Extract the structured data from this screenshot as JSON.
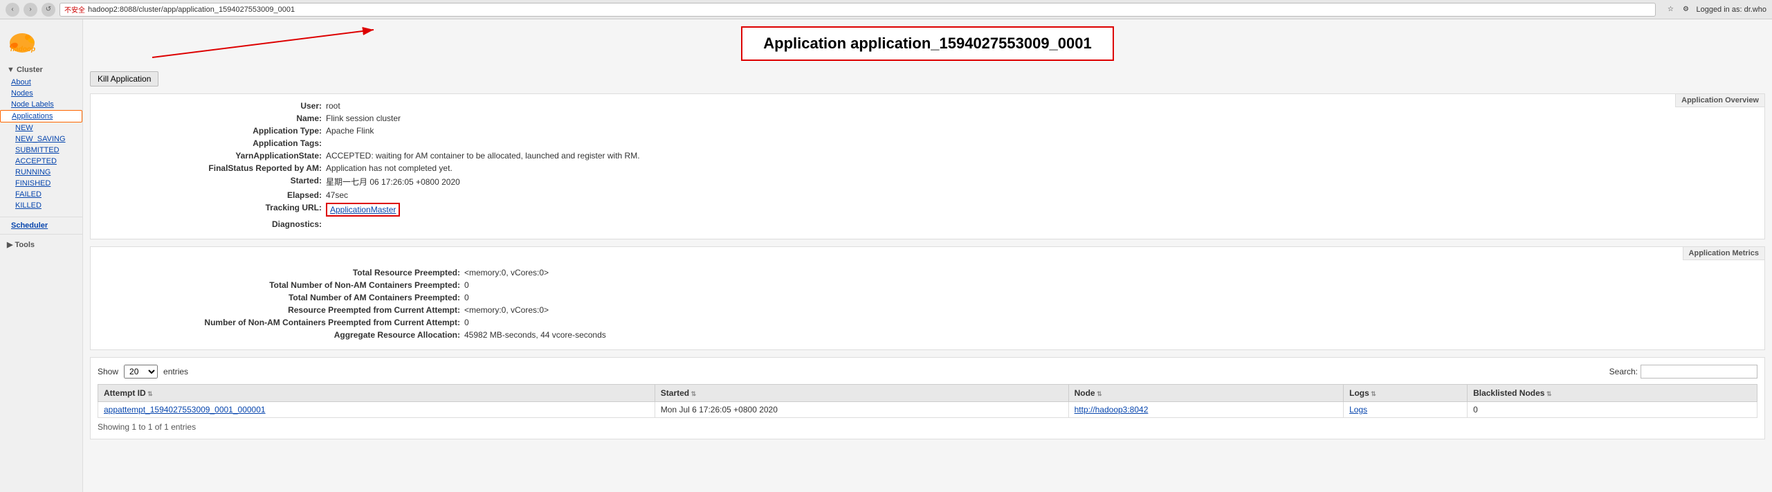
{
  "browser": {
    "url": "hadoop2:8088/cluster/app/application_1594027553009_0001",
    "security_label": "不安全",
    "user_label": "Logged in as: dr.who"
  },
  "hadoop_logo": {
    "text": "hadoop"
  },
  "sidebar": {
    "cluster_title": "▼ Cluster",
    "cluster_items": [
      {
        "label": "About",
        "href": "#",
        "active": false
      },
      {
        "label": "Nodes",
        "href": "#",
        "active": false
      },
      {
        "label": "Node Labels",
        "href": "#",
        "active": false
      },
      {
        "label": "Applications",
        "href": "#",
        "active": true
      }
    ],
    "app_sub_items": [
      {
        "label": "NEW",
        "href": "#"
      },
      {
        "label": "NEW_SAVING",
        "href": "#"
      },
      {
        "label": "SUBMITTED",
        "href": "#"
      },
      {
        "label": "ACCEPTED",
        "href": "#"
      },
      {
        "label": "RUNNING",
        "href": "#"
      },
      {
        "label": "FINISHED",
        "href": "#"
      },
      {
        "label": "FAILED",
        "href": "#"
      },
      {
        "label": "KILLED",
        "href": "#"
      }
    ],
    "scheduler_label": "Scheduler",
    "tools_title": "▶ Tools"
  },
  "page_title": "Application application_1594027553009_0001",
  "kill_button": "Kill Application",
  "info_panel": {
    "header": "Application Overview",
    "fields": [
      {
        "label": "User:",
        "value": "root"
      },
      {
        "label": "Name:",
        "value": "Flink session cluster"
      },
      {
        "label": "Application Type:",
        "value": "Apache Flink"
      },
      {
        "label": "Application Tags:",
        "value": ""
      },
      {
        "label": "YarnApplicationState:",
        "value": "ACCEPTED: waiting for AM container to be allocated, launched and register with RM."
      },
      {
        "label": "FinalStatus Reported by AM:",
        "value": "Application has not completed yet."
      },
      {
        "label": "Started:",
        "value": "星期一七月 06 17:26:05 +0800 2020"
      },
      {
        "label": "Elapsed:",
        "value": "47sec"
      },
      {
        "label": "Tracking URL:",
        "value": "ApplicationMaster",
        "is_link": true,
        "is_boxed": true
      },
      {
        "label": "Diagnostics:",
        "value": ""
      }
    ]
  },
  "metrics_panel": {
    "header": "Application Metrics",
    "fields": [
      {
        "label": "Total Resource Preempted:",
        "value": "<memory:0, vCores:0>"
      },
      {
        "label": "Total Number of Non-AM Containers Preempted:",
        "value": "0"
      },
      {
        "label": "Total Number of AM Containers Preempted:",
        "value": "0"
      },
      {
        "label": "Resource Preempted from Current Attempt:",
        "value": "<memory:0, vCores:0>"
      },
      {
        "label": "Number of Non-AM Containers Preempted from Current Attempt:",
        "value": "0"
      },
      {
        "label": "Aggregate Resource Allocation:",
        "value": "45982 MB-seconds, 44 vcore-seconds"
      }
    ]
  },
  "table": {
    "show_label": "Show",
    "show_value": "20",
    "entries_label": "entries",
    "search_label": "Search:",
    "search_placeholder": "",
    "columns": [
      "Attempt ID",
      "Started",
      "Node",
      "Logs",
      "Blacklisted Nodes"
    ],
    "rows": [
      {
        "attempt_id": "appattempt_1594027553009_0001_000001",
        "attempt_href": "#",
        "started": "Mon Jul 6 17:26:05 +0800 2020",
        "node": "http://hadoop3:8042",
        "node_href": "#",
        "logs": "Logs",
        "logs_href": "#",
        "blacklisted": "0"
      }
    ],
    "showing_text": "Showing 1 to 1 of 1 entries"
  }
}
